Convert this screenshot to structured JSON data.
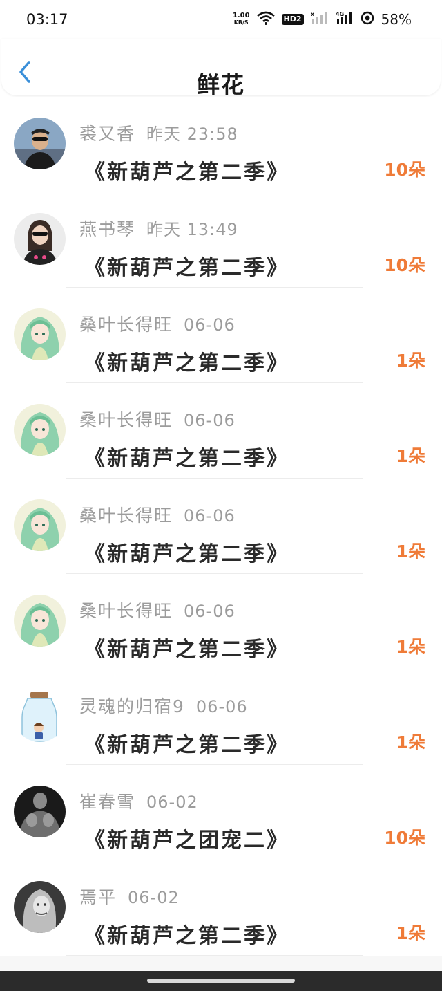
{
  "status_bar": {
    "time": "03:17",
    "net_speed_value": "1.00",
    "net_speed_unit": "KB/S",
    "hd_label": "HD2",
    "battery": "58%"
  },
  "header": {
    "title": "鲜花",
    "back_icon": "chevron-left-icon"
  },
  "colors": {
    "accent": "#3a8fd9",
    "count": "#ef7b38",
    "meta": "#9c9c9c"
  },
  "records": [
    {
      "name": "裘又香",
      "time": "昨天  23:58",
      "work": "《新葫芦之第二季》",
      "count": "10朵",
      "avatar": "man-sunglasses"
    },
    {
      "name": "燕书琴",
      "time": "昨天  13:49",
      "work": "《新葫芦之第二季》",
      "count": "10朵",
      "avatar": "woman-cat-shirt"
    },
    {
      "name": "桑叶长得旺",
      "time": "06-06",
      "work": "《新葫芦之第二季》",
      "count": "1朵",
      "avatar": "anime-green-hair"
    },
    {
      "name": "桑叶长得旺",
      "time": "06-06",
      "work": "《新葫芦之第二季》",
      "count": "1朵",
      "avatar": "anime-green-hair"
    },
    {
      "name": "桑叶长得旺",
      "time": "06-06",
      "work": "《新葫芦之第二季》",
      "count": "1朵",
      "avatar": "anime-green-hair"
    },
    {
      "name": "桑叶长得旺",
      "time": "06-06",
      "work": "《新葫芦之第二季》",
      "count": "1朵",
      "avatar": "anime-green-hair"
    },
    {
      "name": "灵魂的归宿9",
      "time": "06-06",
      "work": "《新葫芦之第二季》",
      "count": "1朵",
      "avatar": "boy-in-jar"
    },
    {
      "name": "崔春雪",
      "time": "06-02",
      "work": "《新葫芦之团宠二》",
      "count": "10朵",
      "avatar": "muscle-man"
    },
    {
      "name": "焉平",
      "time": "06-02",
      "work": "《新葫芦之第二季》",
      "count": "1朵",
      "avatar": "woman-monochrome"
    }
  ]
}
